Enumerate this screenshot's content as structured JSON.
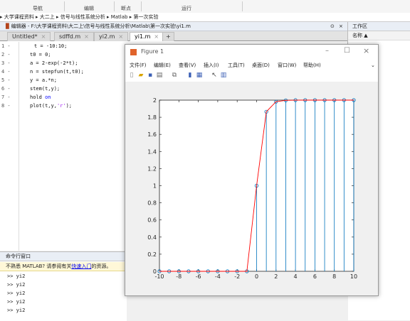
{
  "toolstrip": {
    "groups": [
      "导航",
      "编辑",
      "断点",
      "运行"
    ]
  },
  "address": {
    "path": [
      "大学课程资料",
      "大二上",
      "信号与线性系统分析",
      "Matlab",
      "第一次实验"
    ]
  },
  "editor": {
    "title": "编辑器 - F:\\大学课程资料\\大二上\\信号与线性系统分析\\Matlab\\第一次实验\\yi1.m",
    "tabs": [
      {
        "label": "Untitled*",
        "active": false
      },
      {
        "label": "sdffd.m",
        "active": false
      },
      {
        "label": "yi2.m",
        "active": false
      },
      {
        "label": "yi1.m",
        "active": true
      }
    ],
    "add_tab": "+",
    "lines": [
      {
        "num": "1 -",
        "code": "t = -10:10;"
      },
      {
        "num": "2 -",
        "code": "t0 = 0;"
      },
      {
        "num": "3 -",
        "code": "a = 2-exp(-2*t);"
      },
      {
        "num": "4 -",
        "code": "n = stepfun(t,t0);"
      },
      {
        "num": "5 -",
        "code": "y = a.*n;"
      },
      {
        "num": "6 -",
        "code": "stem(t,y);"
      },
      {
        "num": "7 -",
        "kw": "hold",
        "kw2": "on"
      },
      {
        "num": "8 -",
        "pre": "plot(t,y,",
        "str": "'r'",
        "post": ");"
      }
    ]
  },
  "command_window": {
    "title": "命令行窗口",
    "hint_prefix": "不熟悉 MATLAB? 请参阅有关",
    "hint_link": "快速入门",
    "hint_suffix": "的资源。",
    "lines": [
      ">> yi2",
      ">> yi2",
      ">> yi2",
      ">> yi2",
      ">> yi2"
    ]
  },
  "workspace": {
    "title": "工作区",
    "col_name": "名称 ▲"
  },
  "figure": {
    "title": "Figure 1",
    "menu": [
      "文件(F)",
      "编辑(E)",
      "查看(V)",
      "插入(I)",
      "工具(T)",
      "桌面(D)",
      "窗口(W)",
      "帮助(H)"
    ]
  },
  "chart_data": {
    "type": "line",
    "title": "",
    "xlabel": "",
    "ylabel": "",
    "xlim": [
      -10,
      10
    ],
    "ylim": [
      0,
      2
    ],
    "xticks": [
      -10,
      -8,
      -6,
      -4,
      -2,
      0,
      2,
      4,
      6,
      8,
      10
    ],
    "yticks": [
      0,
      0.2,
      0.4,
      0.6,
      0.8,
      1,
      1.2,
      1.4,
      1.6,
      1.8,
      2
    ],
    "x": [
      -10,
      -9,
      -8,
      -7,
      -6,
      -5,
      -4,
      -3,
      -2,
      -1,
      0,
      1,
      2,
      3,
      4,
      5,
      6,
      7,
      8,
      9,
      10
    ],
    "y": [
      0,
      0,
      0,
      0,
      0,
      0,
      0,
      0,
      0,
      0,
      1,
      1.8647,
      1.9817,
      1.9975,
      1.9997,
      2,
      2,
      2,
      2,
      2,
      2
    ],
    "series": [
      {
        "kind": "stem",
        "color": "#0072bd"
      },
      {
        "kind": "line",
        "color": "#ff0000"
      }
    ],
    "grid": false
  }
}
